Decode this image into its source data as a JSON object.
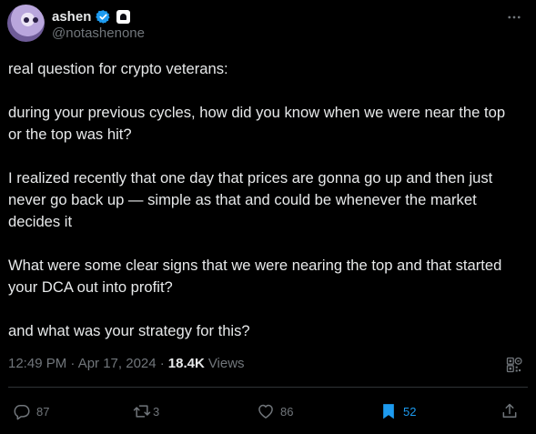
{
  "author": {
    "name": "ashen",
    "handle": "@notashenone"
  },
  "tweet": {
    "paragraphs": [
      "real question for crypto veterans:",
      "during your previous cycles, how did you know when we were near the top or the top was hit?",
      "I realized recently that one day that prices are gonna go up and then just never go back up — simple as that and could be whenever the market decides it",
      "What were some clear signs that we were nearing the top and that started your DCA out into profit?",
      "and what was your strategy for this?"
    ]
  },
  "meta": {
    "timestamp": "12:49 PM · Apr 17, 2024 ·",
    "views_count": "18.4K",
    "views_label": "Views"
  },
  "actions": {
    "replies": "87",
    "reposts": "3",
    "likes": "86",
    "bookmarks": "52"
  },
  "colors": {
    "background": "#000000",
    "text": "#e7e9ea",
    "muted": "#71767b",
    "accent": "#1d9bf0"
  },
  "icons": {
    "verified": "verified-badge-icon",
    "affiliate": "affiliate-badge-icon",
    "more": "more-options-icon",
    "reply": "reply-icon",
    "repost": "repost-icon",
    "like": "heart-icon",
    "bookmark": "bookmark-icon",
    "share": "share-icon",
    "analytics": "view-analytics-icon"
  }
}
